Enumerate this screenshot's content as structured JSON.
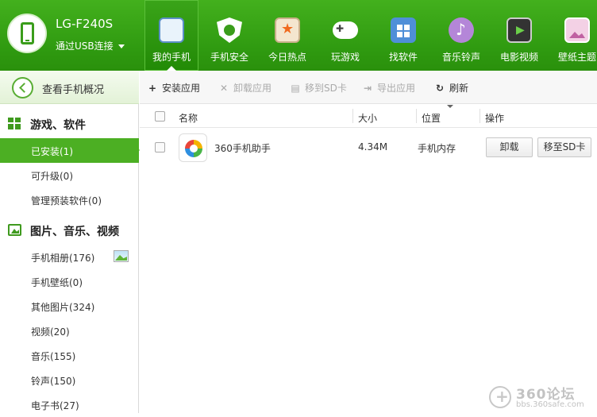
{
  "device": {
    "name": "LG-F240S",
    "connection": "通过USB连接"
  },
  "top_tabs": [
    {
      "label": "我的手机",
      "icon": "phone-icon",
      "active": true
    },
    {
      "label": "手机安全",
      "icon": "shield-icon"
    },
    {
      "label": "今日热点",
      "icon": "news-icon"
    },
    {
      "label": "玩游戏",
      "icon": "gamepad-icon"
    },
    {
      "label": "找软件",
      "icon": "app-store-icon"
    },
    {
      "label": "音乐铃声",
      "icon": "music-icon"
    },
    {
      "label": "电影视频",
      "icon": "film-icon"
    },
    {
      "label": "壁纸主题",
      "icon": "wallpaper-icon"
    }
  ],
  "sidebar": {
    "overview_label": "查看手机概况",
    "section_apps": "游戏、软件",
    "section_media": "图片、音乐、视频",
    "items": [
      {
        "label": "已安装(1)",
        "active": true
      },
      {
        "label": "可升级(0)"
      },
      {
        "label": "管理预装软件(0)"
      },
      {
        "label": "手机相册(176)"
      },
      {
        "label": "手机壁纸(0)"
      },
      {
        "label": "其他图片(324)"
      },
      {
        "label": "视频(20)"
      },
      {
        "label": "音乐(155)"
      },
      {
        "label": "铃声(150)"
      },
      {
        "label": "电子书(27)"
      }
    ]
  },
  "toolbar": {
    "install": "安装应用",
    "uninstall": "卸载应用",
    "move_sd": "移到SD卡",
    "export": "导出应用",
    "refresh": "刷新"
  },
  "table": {
    "headers": {
      "name": "名称",
      "size": "大小",
      "location": "位置",
      "actions": "操作"
    },
    "rows": [
      {
        "name": "360手机助手",
        "size": "4.34M",
        "location": "手机内存",
        "uninstall_label": "卸载",
        "move_label": "移至SD卡"
      }
    ]
  },
  "watermark": {
    "title": "360论坛",
    "url": "bbs.360safe.com"
  },
  "colors": {
    "accent": "#43b01d",
    "active_nav": "#4caf23"
  }
}
